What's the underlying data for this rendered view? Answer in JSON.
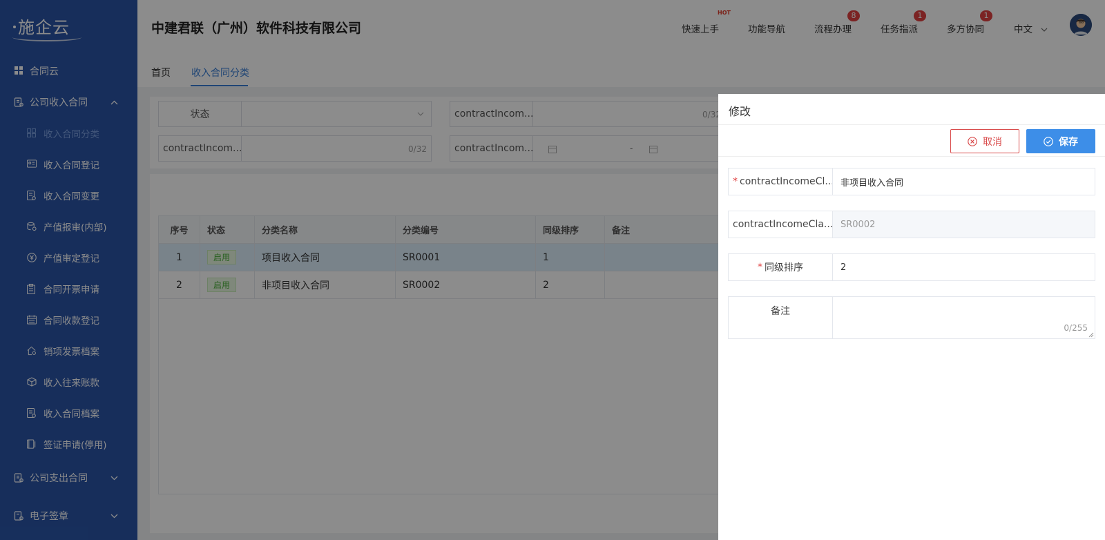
{
  "sidebar": {
    "logo": "施企云",
    "top_item": "合同云",
    "group1": "公司收入合同",
    "items": [
      {
        "label": "收入合同分类",
        "icon": "grid-icon"
      },
      {
        "label": "收入合同登记",
        "icon": "id-card-icon"
      },
      {
        "label": "收入合同变更",
        "icon": "document-edit-icon"
      },
      {
        "label": "产值报审(内部)",
        "icon": "database-icon"
      },
      {
        "label": "产值审定登记",
        "icon": "yen-circle-icon"
      },
      {
        "label": "合同开票申请",
        "icon": "clipboard-icon"
      },
      {
        "label": "合同收款登记",
        "icon": "calendar-icon"
      },
      {
        "label": "销项发票档案",
        "icon": "house-icon"
      },
      {
        "label": "收入往来账款",
        "icon": "cube-icon"
      },
      {
        "label": "收入合同档案",
        "icon": "file-icon"
      },
      {
        "label": "签证申请(停用)",
        "icon": "book-edit-icon"
      }
    ],
    "group2": "公司支出合同",
    "group3": "电子签章"
  },
  "header": {
    "company": "中建君联（广州）软件科技有限公司",
    "nav": [
      {
        "label": "快速上手",
        "badge": "HOT"
      },
      {
        "label": "功能导航",
        "badge": ""
      },
      {
        "label": "流程办理",
        "badge": "8"
      },
      {
        "label": "任务指派",
        "badge": "1"
      },
      {
        "label": "多方协同",
        "badge": "1"
      }
    ],
    "language": "中文"
  },
  "tabs": {
    "home": "首页",
    "current": "收入合同分类"
  },
  "filters": {
    "status_label": "状态",
    "f2_label": "contractIncom...",
    "f2_count": "0/32",
    "f3_label": "contractIncom...",
    "f3_count": "0/32",
    "f4_label": "contractIncom...",
    "date_sep": "-"
  },
  "table": {
    "headers": [
      "序号",
      "状态",
      "分类名称",
      "分类编号",
      "同级排序",
      "备注"
    ],
    "rows": [
      {
        "no": "1",
        "status": "启用",
        "name": "项目收入合同",
        "code": "SR0001",
        "sort": "1",
        "remark": ""
      },
      {
        "no": "2",
        "status": "启用",
        "name": "非项目收入合同",
        "code": "SR0002",
        "sort": "2",
        "remark": ""
      }
    ]
  },
  "drawer": {
    "title": "修改",
    "cancel": "取消",
    "save": "保存",
    "fields": {
      "name_label": "contractIncomeCl...",
      "name_value": "非项目收入合同",
      "code_label": "contractIncomeCla...",
      "code_value": "SR0002",
      "sort_label": "同级排序",
      "sort_value": "2",
      "remark_label": "备注",
      "remark_count": "0/255"
    }
  }
}
